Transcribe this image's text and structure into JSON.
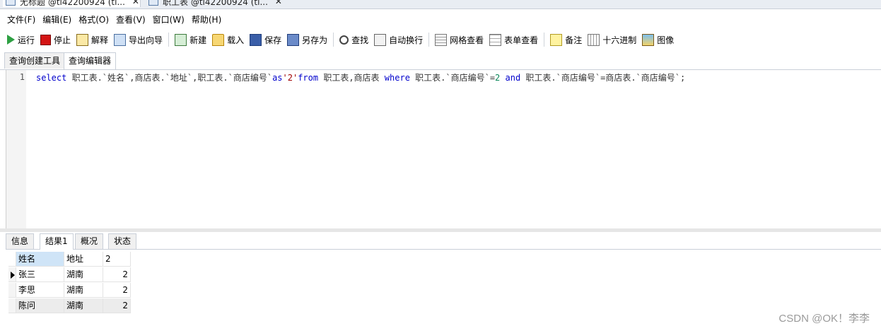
{
  "doc_tabs": [
    {
      "label": "无标题 @tl42200924 (tl...",
      "close": "✕"
    },
    {
      "label": "职工表 @tl42200924 (tl...",
      "close": "✕"
    }
  ],
  "menu": [
    "文件(F)",
    "编辑(E)",
    "格式(O)",
    "查看(V)",
    "窗口(W)",
    "帮助(H)"
  ],
  "toolbar": {
    "run": "运行",
    "stop": "停止",
    "explain": "解释",
    "export": "导出向导",
    "new": "新建",
    "load": "载入",
    "save": "保存",
    "saveas": "另存为",
    "find": "查找",
    "wrap": "自动换行",
    "grid_view": "网格查看",
    "form_view": "表单查看",
    "memo": "备注",
    "hex": "十六进制",
    "image": "图像"
  },
  "query_tabs": [
    "查询创建工具",
    "查询编辑器"
  ],
  "editor": {
    "line_number": "1",
    "tokens": [
      {
        "t": "select",
        "c": "kw"
      },
      {
        "t": " 职工表.`姓名`,商店表.`地址`,职工表.`商店编号`",
        "c": ""
      },
      {
        "t": "as",
        "c": "kw"
      },
      {
        "t": "'2'",
        "c": "str"
      },
      {
        "t": "from",
        "c": "kw"
      },
      {
        "t": " 职工表,商店表 ",
        "c": ""
      },
      {
        "t": "where",
        "c": "kw"
      },
      {
        "t": " 职工表.`商店编号`=",
        "c": ""
      },
      {
        "t": "2",
        "c": "num"
      },
      {
        "t": " ",
        "c": ""
      },
      {
        "t": "and",
        "c": "kw"
      },
      {
        "t": " 职工表.`商店编号`=商店表.`商店编号`;",
        "c": ""
      }
    ]
  },
  "result_tabs": [
    "信息",
    "结果1",
    "概况",
    "状态"
  ],
  "grid": {
    "columns": [
      "姓名",
      "地址",
      "2"
    ],
    "rows": [
      [
        "张三",
        "湖南",
        "2"
      ],
      [
        "李思",
        "湖南",
        "2"
      ],
      [
        "陈问",
        "湖南",
        "2"
      ]
    ]
  },
  "watermark": "CSDN @OK！李李"
}
